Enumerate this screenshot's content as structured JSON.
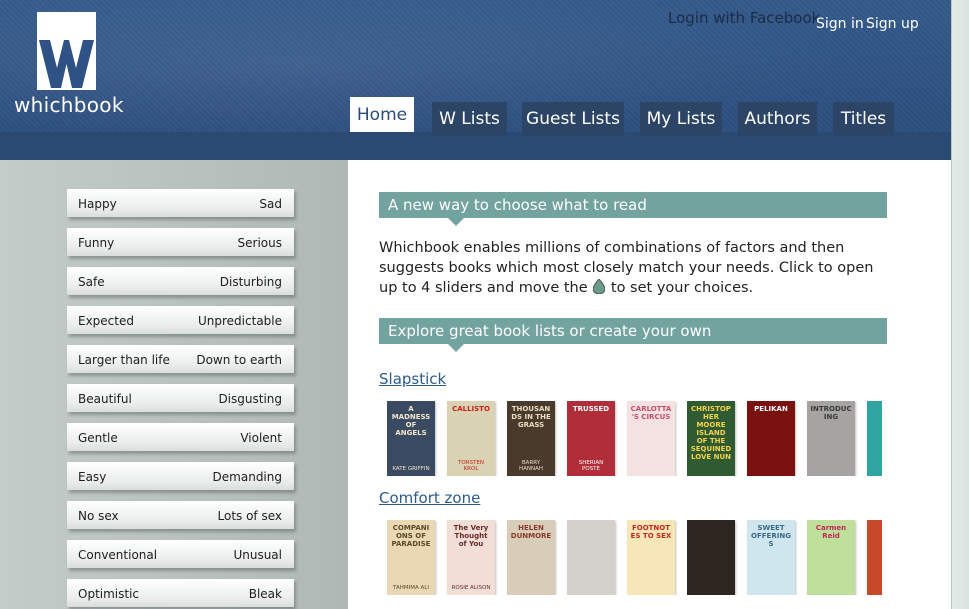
{
  "brand": {
    "logo_letter": "W",
    "name": "whichbook"
  },
  "top_links": {
    "facebook": "Login with Facebook",
    "sign_in": "Sign in",
    "sign_up": "Sign up"
  },
  "nav": {
    "tabs": [
      {
        "label": "Home",
        "active": true
      },
      {
        "label": "W Lists"
      },
      {
        "label": "Guest Lists"
      },
      {
        "label": "My Lists"
      },
      {
        "label": "Authors"
      },
      {
        "label": "Titles"
      }
    ]
  },
  "sliders": [
    {
      "left": "Happy",
      "right": "Sad"
    },
    {
      "left": "Funny",
      "right": "Serious"
    },
    {
      "left": "Safe",
      "right": "Disturbing"
    },
    {
      "left": "Expected",
      "right": "Unpredictable"
    },
    {
      "left": "Larger than life",
      "right": "Down to earth"
    },
    {
      "left": "Beautiful",
      "right": "Disgusting"
    },
    {
      "left": "Gentle",
      "right": "Violent"
    },
    {
      "left": "Easy",
      "right": "Demanding"
    },
    {
      "left": "No sex",
      "right": "Lots of sex"
    },
    {
      "left": "Conventional",
      "right": "Unusual"
    },
    {
      "left": "Optimistic",
      "right": "Bleak"
    }
  ],
  "main": {
    "section1_title": "A new way to choose what to read",
    "intro_part1": "Whichbook enables millions of combinations of factors and then suggests books which most closely match your needs. Click to open up to 4 sliders and move the",
    "intro_part2": "to set your choices.",
    "section2_title": "Explore great book lists or create your own",
    "lists": [
      {
        "name": "Slapstick",
        "books": [
          {
            "title": "A MADNESS OF ANGELS",
            "author": "KATE GRIFFIN",
            "bg": "#3b4a63",
            "fg": "#f2e6c9"
          },
          {
            "title": "CALLISTO",
            "author": "TORSTEN KROL",
            "bg": "#d9d2b3",
            "fg": "#c4231c"
          },
          {
            "title": "THOUSANDS IN THE GRASS",
            "author": "BARRY HANNAH",
            "bg": "#4a3a2c",
            "fg": "#e8dcc0"
          },
          {
            "title": "TRUSSED",
            "author": "SHERIAN POSTE",
            "bg": "#b02e3a",
            "fg": "#ffffff"
          },
          {
            "title": "CARLOTTA'S CIRCUS",
            "author": "",
            "bg": "#f4e2e2",
            "fg": "#c0506a"
          },
          {
            "title": "CHRISTOPHER MOORE ISLAND OF THE SEQUINED LOVE NUN",
            "author": "",
            "bg": "#2f5a32",
            "fg": "#f3d34a"
          },
          {
            "title": "PELIKAN",
            "author": "",
            "bg": "#7a1111",
            "fg": "#ffffff"
          },
          {
            "title": "INTRODUCING",
            "author": "",
            "bg": "#a6a4a2",
            "fg": "#3a3a3a"
          },
          {
            "title": "",
            "author": "",
            "bg": "#2ea5a0",
            "fg": "#ffffff"
          }
        ]
      },
      {
        "name": "Comfort zone",
        "books": [
          {
            "title": "COMPANIONS OF PARADISE",
            "author": "TAHMIMA ALI",
            "bg": "#e9d8b3",
            "fg": "#5a4a2a"
          },
          {
            "title": "The Very Thought of You",
            "author": "ROSIE ALISON",
            "bg": "#f1ded6",
            "fg": "#6a2a2a"
          },
          {
            "title": "HELEN DUNMORE",
            "author": "",
            "bg": "#d8cdb9",
            "fg": "#8a3a2a"
          },
          {
            "title": "",
            "author": "",
            "bg": "#d4d0cc",
            "fg": "#222222"
          },
          {
            "title": "FOOTNOTES TO SEX",
            "author": "",
            "bg": "#f6e6b8",
            "fg": "#c4281c"
          },
          {
            "title": "",
            "author": "",
            "bg": "#2c2520",
            "fg": "#f0e0c0"
          },
          {
            "title": "SWEET OFFERINGS",
            "author": "",
            "bg": "#cfe6ee",
            "fg": "#3a6a8a"
          },
          {
            "title": "Carmen Reid",
            "author": "",
            "bg": "#bfe09a",
            "fg": "#c0285a"
          },
          {
            "title": "",
            "author": "",
            "bg": "#c64a2a",
            "fg": "#ffffff"
          }
        ]
      }
    ]
  }
}
